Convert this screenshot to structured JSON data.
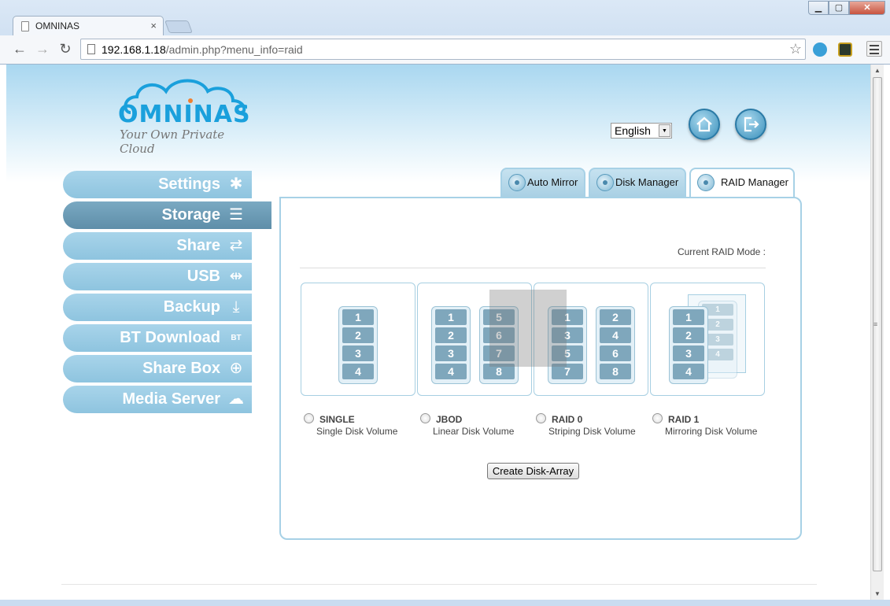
{
  "browser": {
    "tab_title": "OMNINAS",
    "url_host": "192.168.1.18",
    "url_path": "/admin.php?menu_info=raid"
  },
  "header": {
    "logo_text": "OMNINAS",
    "logo_tagline": "Your Own Private Cloud",
    "language": "English"
  },
  "sidebar": {
    "items": [
      {
        "label": "Settings",
        "icon": "snowflake-icon"
      },
      {
        "label": "Storage",
        "icon": "storage-stack-icon",
        "active": true
      },
      {
        "label": "Share",
        "icon": "share-arrows-icon"
      },
      {
        "label": "USB",
        "icon": "usb-icon"
      },
      {
        "label": "Backup",
        "icon": "backup-icon"
      },
      {
        "label": "BT Download",
        "icon": "bt-download-icon"
      },
      {
        "label": "Share Box",
        "icon": "share-box-icon"
      },
      {
        "label": "Media Server",
        "icon": "media-server-icon"
      }
    ]
  },
  "tabs": [
    {
      "label": "Auto Mirror"
    },
    {
      "label": "Disk Manager"
    },
    {
      "label": "RAID Manager",
      "active": true
    }
  ],
  "raid": {
    "current_mode_label": "Current RAID Mode :",
    "options": [
      {
        "name": "SINGLE",
        "desc": "Single Disk Volume"
      },
      {
        "name": "JBOD",
        "desc": "Linear Disk Volume"
      },
      {
        "name": "RAID 0",
        "desc": "Striping Disk Volume"
      },
      {
        "name": "RAID 1",
        "desc": "Mirroring Disk Volume"
      }
    ],
    "diagrams": {
      "single": [
        [
          "1",
          "2",
          "3",
          "4"
        ]
      ],
      "jbod": [
        [
          "1",
          "2",
          "3",
          "4"
        ],
        [
          "5",
          "6",
          "7",
          "8"
        ]
      ],
      "raid0": [
        [
          "1",
          "3",
          "5",
          "7"
        ],
        [
          "2",
          "4",
          "6",
          "8"
        ]
      ],
      "raid1": [
        [
          "1",
          "2",
          "3",
          "4"
        ]
      ]
    },
    "create_button": "Create Disk-Array"
  },
  "colors": {
    "accent": "#1aa0dc",
    "menu_bg": "#8ec4df",
    "menu_active_bg": "#5e8ea9",
    "panel_border": "#a7d1e6",
    "disk_slot": "#7fa7bc"
  }
}
